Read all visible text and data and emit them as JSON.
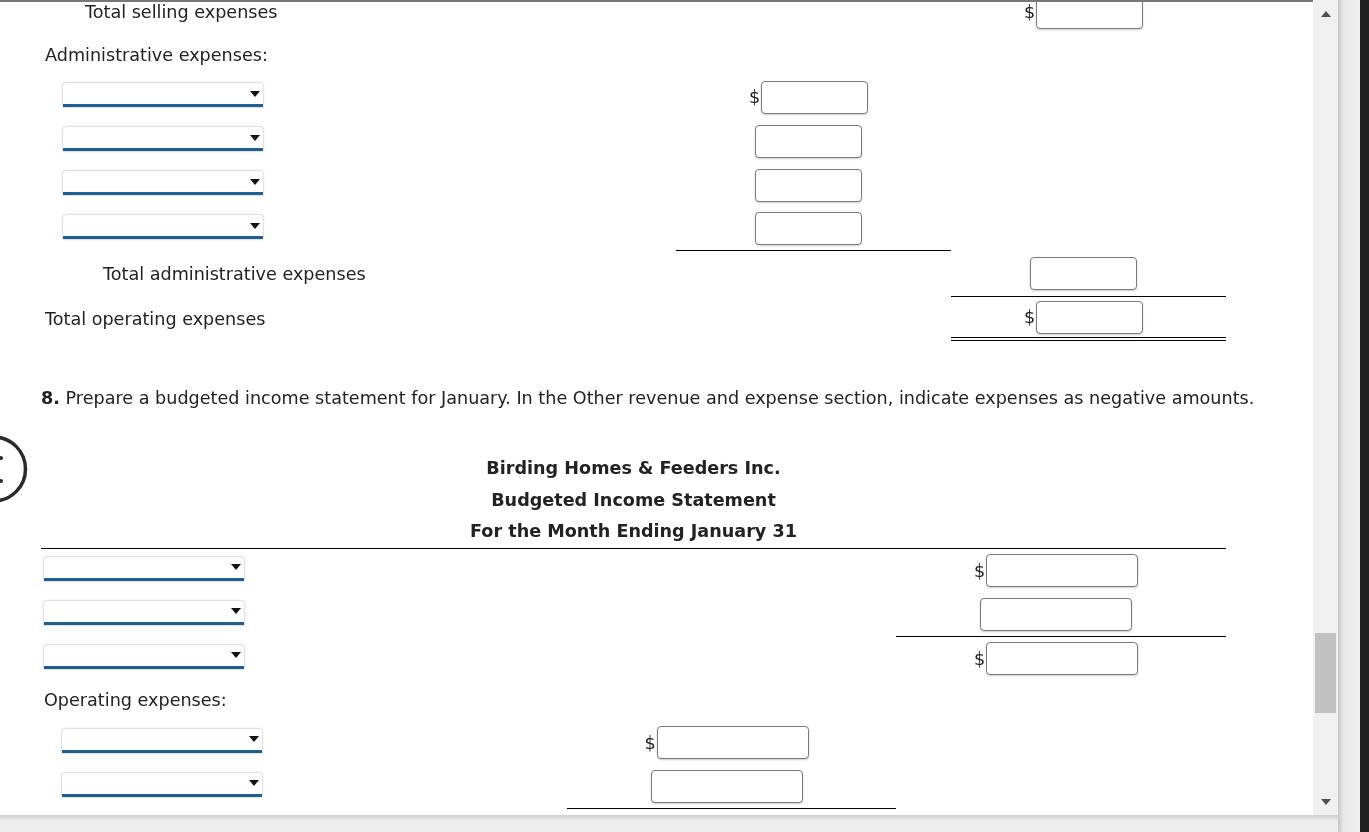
{
  "schedule": {
    "rows": [
      {
        "kind": "total",
        "label": "Total selling expenses",
        "total_amount": {
          "prefix": "$",
          "underline": false,
          "double_underline": false
        }
      },
      {
        "kind": "label",
        "label": "Administrative expenses:",
        "children": [
          {
            "kind": "select",
            "amount": {
              "prefix": "$",
              "underline": false,
              "double_underline": false
            }
          },
          {
            "kind": "select",
            "amount": {
              "underline": false,
              "double_underline": false
            }
          },
          {
            "kind": "select",
            "amount": {
              "underline": false,
              "double_underline": false
            }
          },
          {
            "kind": "select",
            "amount": {
              "underline": true,
              "double_underline": false
            }
          },
          {
            "kind": "total",
            "label": "Total administrative expenses",
            "total_amount": {
              "underline": true,
              "double_underline": false
            }
          }
        ]
      },
      {
        "kind": "label",
        "label": "Total operating expenses",
        "total_amount": {
          "prefix": "$",
          "underline": false,
          "double_underline": true
        }
      }
    ]
  },
  "income_statement": {
    "instruction": "**8.** Prepare a budgeted income statement for January. In the Other revenue and expense section, indicate expenses as negative amounts.",
    "title_lines": [
      "Birding Homes & Feeders Inc.",
      "Budgeted Income Statement",
      "For the Month Ending January 31"
    ],
    "rows": [
      {
        "kind": "select",
        "total_amount": {
          "prefix": "$",
          "underline": false,
          "double_underline": false
        }
      },
      {
        "kind": "select",
        "total_amount": {
          "underline": true,
          "double_underline": false
        }
      },
      {
        "kind": "select",
        "total_amount": {
          "prefix": "$",
          "underline": false,
          "double_underline": false
        }
      },
      {
        "kind": "label",
        "label": "Operating expenses:",
        "children": [
          {
            "kind": "select",
            "amount": {
              "prefix": "$",
              "underline": false,
              "double_underline": false
            }
          },
          {
            "kind": "select",
            "amount": {
              "underline": true,
              "double_underline": false
            }
          }
        ]
      }
    ]
  }
}
